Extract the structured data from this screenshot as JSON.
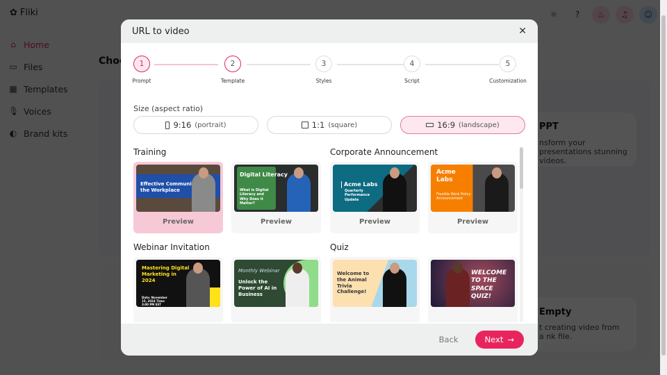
{
  "app": {
    "logo": "Fliki",
    "nav": [
      {
        "label": "Home",
        "icon": "home-icon"
      },
      {
        "label": "Files",
        "icon": "folder-icon"
      },
      {
        "label": "Templates",
        "icon": "layout-icon"
      },
      {
        "label": "Voices",
        "icon": "mic-icon"
      },
      {
        "label": "Brand kits",
        "icon": "palette-icon"
      }
    ],
    "page_title": "Choo",
    "card_ppt_title": "PPT",
    "card_ppt_desc": "nsform your presentations stunning videos.",
    "card_empty_title": "Empty",
    "card_empty_desc": "t creating video from a nk file."
  },
  "modal": {
    "title": "URL to video",
    "steps": [
      {
        "n": "1",
        "label": "Prompt"
      },
      {
        "n": "2",
        "label": "Template"
      },
      {
        "n": "3",
        "label": "Styles"
      },
      {
        "n": "4",
        "label": "Script"
      },
      {
        "n": "5",
        "label": "Customization"
      }
    ],
    "size_label": "Size (aspect ratio)",
    "sizes": [
      {
        "ratio": "9:16",
        "desc": "(portrait)"
      },
      {
        "ratio": "1:1",
        "desc": "(square)"
      },
      {
        "ratio": "16:9",
        "desc": "(landscape)",
        "selected": true
      }
    ],
    "categories": [
      {
        "name": "Training",
        "templates": [
          {
            "text": "Effective Communication in the Workplace",
            "preview": "Preview",
            "selected": true
          },
          {
            "text": "Digital Literacy",
            "sub": "What is Digital Literacy and Why Does it Matter?",
            "preview": "Preview"
          }
        ]
      },
      {
        "name": "Corporate Announcement",
        "templates": [
          {
            "text": "Acme Labs",
            "sub": "Quarterly Performance Update",
            "preview": "Preview"
          },
          {
            "text": "Acme Labs",
            "sub": "Flexible Work Policy Announcement",
            "preview": "Preview"
          }
        ]
      },
      {
        "name": "Webinar Invitation",
        "templates": [
          {
            "text": "Mastering Digital Marketing in 2024",
            "sub": "Date: November 15, 2024 Time: 3:00 PM EST"
          },
          {
            "text": "Unlock the Power of AI in Business",
            "sub": "Monthly Webinar"
          }
        ]
      },
      {
        "name": "Quiz",
        "templates": [
          {
            "text": "Welcome to the Animal Trivia Challenge!"
          },
          {
            "text": "WELCOME TO THE SPACE QUIZ!"
          }
        ]
      }
    ],
    "back": "Back",
    "next": "Next"
  },
  "colors": {
    "accent": "#e8245e"
  }
}
